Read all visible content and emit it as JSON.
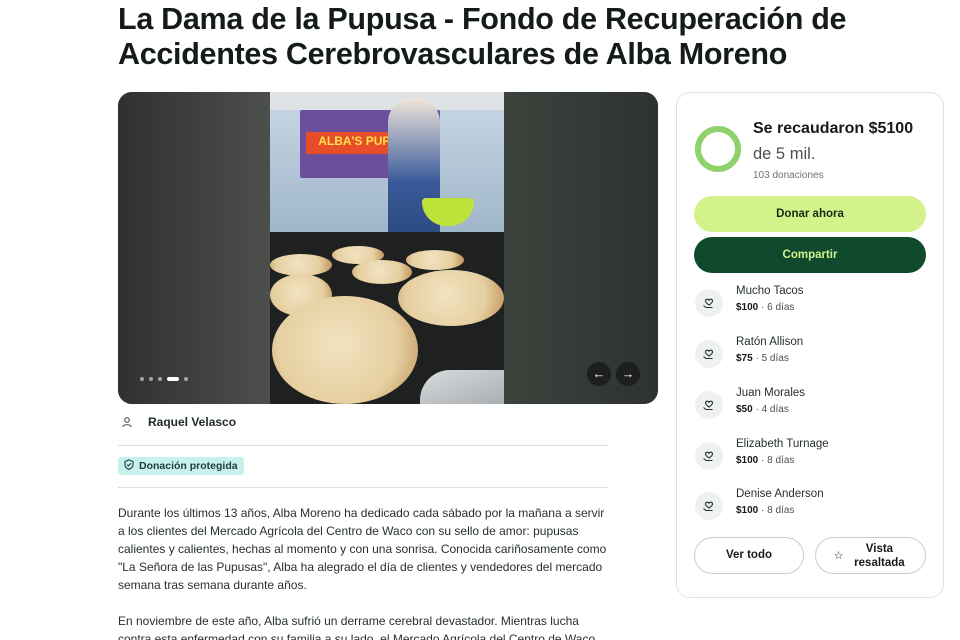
{
  "page": {
    "title": "La Dama de la Pupusa - Fondo de Recuperación de Accidentes Cerebrovasculares de Alba Moreno"
  },
  "gallery": {
    "sign_text": "ALBA'S PUPUSAS",
    "slide_count": 5,
    "active_slide": 3,
    "prev_icon": "arrow-left-icon",
    "next_icon": "arrow-right-icon"
  },
  "organizer": {
    "name": "Raquel Velasco",
    "icon": "user-icon"
  },
  "badge": {
    "label": "Donación protegida",
    "icon": "shield-icon"
  },
  "story": {
    "paragraphs": [
      "Durante los últimos 13 años, Alba Moreno ha dedicado cada sábado por la mañana a servir a los clientes del Mercado Agrícola del Centro de Waco con su sello de amor: pupusas calientes y calientes, hechas al momento y con una sonrisa. Conocida cariñosamente como \"La Señora de las Pupusas\", Alba ha alegrado el día de clientes y vendedores del mercado semana tras semana durante años.",
      "En noviembre de este año, Alba sufrió un derrame cerebral devastador. Mientras lucha contra esta enfermedad con su familia a su lado, el Mercado Agrícola del Centro de Waco"
    ]
  },
  "donation": {
    "raised_text": "Se recaudaron $5100",
    "goal_text": "de 5 mil.",
    "count_text": "103 donaciones",
    "progress": 1.0,
    "donate_label": "Donar ahora",
    "share_label": "Compartir",
    "donors": [
      {
        "name": "Mucho Tacos",
        "amount": "$100",
        "time": " · 6 días"
      },
      {
        "name": "Ratón Allison",
        "amount": "$75",
        "time": " · 5 días"
      },
      {
        "name": "Juan Morales",
        "amount": "$50",
        "time": " · 4 días"
      },
      {
        "name": "Elizabeth Turnage",
        "amount": "$100",
        "time": " · 8 días"
      },
      {
        "name": "Denise Anderson",
        "amount": "$100",
        "time": " · 8 días"
      }
    ],
    "see_all_label": "Ver todo",
    "featured_label": "Vista resaltada",
    "donor_icon": "heart-hand-icon",
    "featured_icon": "star-icon"
  },
  "colors": {
    "accent_light": "#d3f28a",
    "accent_dark": "#0f4a2d",
    "ring": "#8fd16a",
    "badge_bg": "#c8f1ee"
  }
}
